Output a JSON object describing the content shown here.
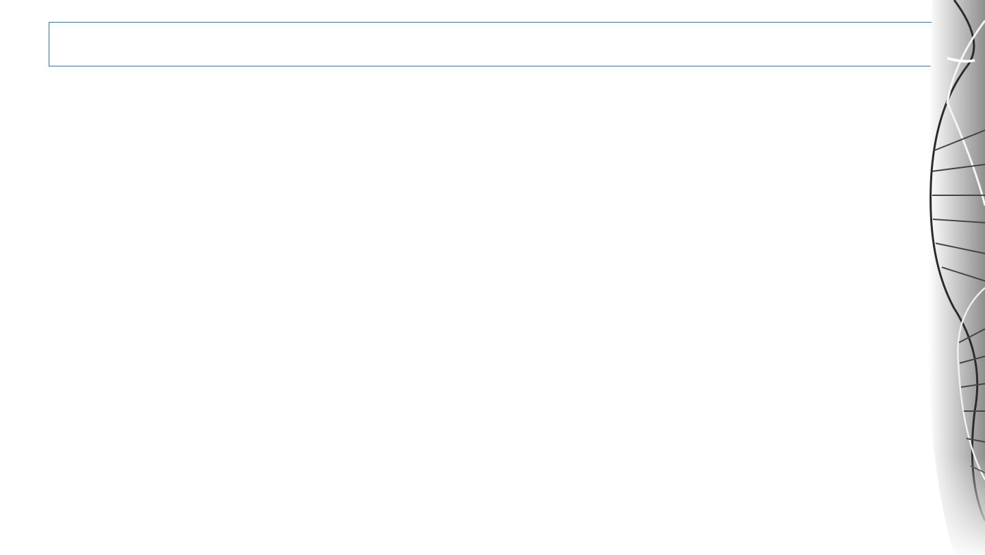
{
  "slide": {
    "title_text": ""
  },
  "decoration": {
    "icon": "dna-helix-image"
  },
  "colors": {
    "title_border": "#3d6f94",
    "background": "#ffffff"
  }
}
